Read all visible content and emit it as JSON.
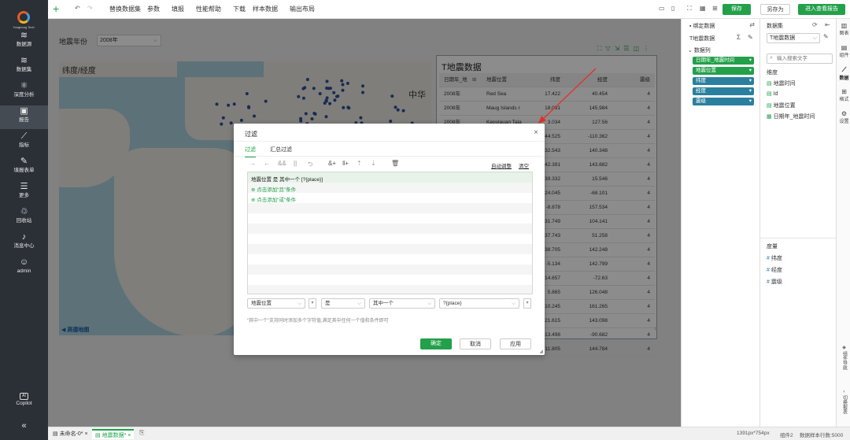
{
  "brand": {
    "logo_text": "Yonghong Tech"
  },
  "nav": [
    {
      "label": "数据源",
      "icon": "database-icon",
      "glyph": "≋"
    },
    {
      "label": "数据集",
      "icon": "dataset-icon",
      "glyph": "≋"
    },
    {
      "label": "深度分析",
      "icon": "analysis-icon",
      "glyph": "⚛"
    },
    {
      "label": "报告",
      "icon": "report-icon",
      "glyph": "▣"
    },
    {
      "label": "指标",
      "icon": "metric-icon",
      "glyph": "⟋"
    },
    {
      "label": "填报表单",
      "icon": "form-icon",
      "glyph": "✎"
    },
    {
      "label": "更多",
      "icon": "more-icon",
      "glyph": "☰"
    },
    {
      "label": "回收站",
      "icon": "trash-icon",
      "glyph": "♲"
    },
    {
      "label": "消息中心",
      "icon": "bell-icon",
      "glyph": "♪"
    },
    {
      "label": "admin",
      "icon": "user-icon",
      "glyph": "☺"
    }
  ],
  "copilot": {
    "label": "Copilot",
    "badge": "AI"
  },
  "toolbar": {
    "items": [
      "替换数据集",
      "参数",
      "填报",
      "性能帮助",
      "下载",
      "样本数据",
      "输出布局"
    ],
    "save": "保存",
    "save_as": "另存为",
    "open_view": "进入查看报告"
  },
  "filter_widget": {
    "label": "地震年份",
    "value": "2008年"
  },
  "map": {
    "title": "纬度/经度",
    "region_label": "中华",
    "attribution": "高德地图"
  },
  "table": {
    "title": "T地震数据",
    "columns": [
      "日期年_地",
      "地震位置",
      "纬度",
      "经度",
      "震级"
    ],
    "rows": [
      [
        "2008年",
        "Red Sea",
        "17.422",
        "40.454",
        "4"
      ],
      [
        "2008年",
        "Maug Islands r",
        "18.091",
        "145.984",
        "4"
      ],
      [
        "2008年",
        "Kepulauan Tala",
        "3.034",
        "127.56",
        "4"
      ],
      [
        "",
        "",
        "44.525",
        "-110.362",
        "4"
      ],
      [
        "",
        "",
        "32.543",
        "140.348",
        "4"
      ],
      [
        "",
        "",
        "42.391",
        "143.882",
        "4"
      ],
      [
        "",
        "",
        "39.332",
        "15.546",
        "4"
      ],
      [
        "",
        "",
        "-24.045",
        "-68.101",
        "4"
      ],
      [
        "",
        "",
        "-8.878",
        "157.534",
        "4"
      ],
      [
        "",
        "",
        "31.749",
        "104.141",
        "4"
      ],
      [
        "",
        "",
        "-37.743",
        "51.258",
        "4"
      ],
      [
        "",
        "",
        "38.705",
        "142.248",
        "4"
      ],
      [
        "",
        "",
        "-5.134",
        "142.799",
        "4"
      ],
      [
        "",
        "",
        "-14.657",
        "-72.63",
        "4"
      ],
      [
        "",
        "",
        "5.865",
        "126.048",
        "4"
      ],
      [
        "",
        "",
        "-10.245",
        "161.265",
        "4"
      ],
      [
        "",
        "",
        "21.615",
        "143.098",
        "4"
      ],
      [
        "",
        "",
        "13.498",
        "-90.682",
        "4"
      ],
      [
        "",
        "",
        "11.805",
        "144.784",
        "4"
      ]
    ]
  },
  "bind_panel": {
    "title": "绑定数据",
    "source": "T地震数据",
    "data_section": "数据列",
    "pills": [
      {
        "label": "日期年_地震时间",
        "color": "#23a04a"
      },
      {
        "label": "地震位置",
        "color": "#23a04a"
      },
      {
        "label": "纬度",
        "color": "#2a7f9e"
      },
      {
        "label": "经度",
        "color": "#2a7f9e"
      },
      {
        "label": "震级",
        "color": "#2a7f9e"
      }
    ]
  },
  "dataset_panel": {
    "title": "数据集",
    "dataset": "T地震数据",
    "search_placeholder": "输入搜索文字",
    "dims_header": "维度",
    "dims": [
      "地震时间",
      "Id",
      "地震位置",
      "日期年_地震时间"
    ],
    "measures_header": "度量",
    "measures": [
      "纬度",
      "经度",
      "震级"
    ]
  },
  "right_strip": [
    "图表",
    "组件",
    "数据",
    "格式",
    "设置"
  ],
  "right_strip_bottom": [
    "组件导航",
    "切换报表"
  ],
  "dialog": {
    "title": "过滤",
    "tabs": [
      "过滤",
      "汇总过滤"
    ],
    "auto_adjust": "自动调整",
    "clear": "清空",
    "condition": "地震位置 是 其中一个 [?{place}]",
    "add_and": "点击添加“且”条件",
    "add_or": "点击添加“或”条件",
    "field_select": "地震位置",
    "op_select": "是",
    "mode_select": "其中一个",
    "value_select": "?{place}",
    "hint": "“其中一个”支持同时添加多个字符值,满足其中任何一个值和条件即可",
    "ok": "确定",
    "cancel": "取消",
    "apply": "应用"
  },
  "bottom": {
    "tabs": [
      "未命名-0*",
      "地震数据*"
    ],
    "size": "1391px*754px",
    "components": "组件2",
    "sample_rows": "数据样本行数:5000"
  }
}
